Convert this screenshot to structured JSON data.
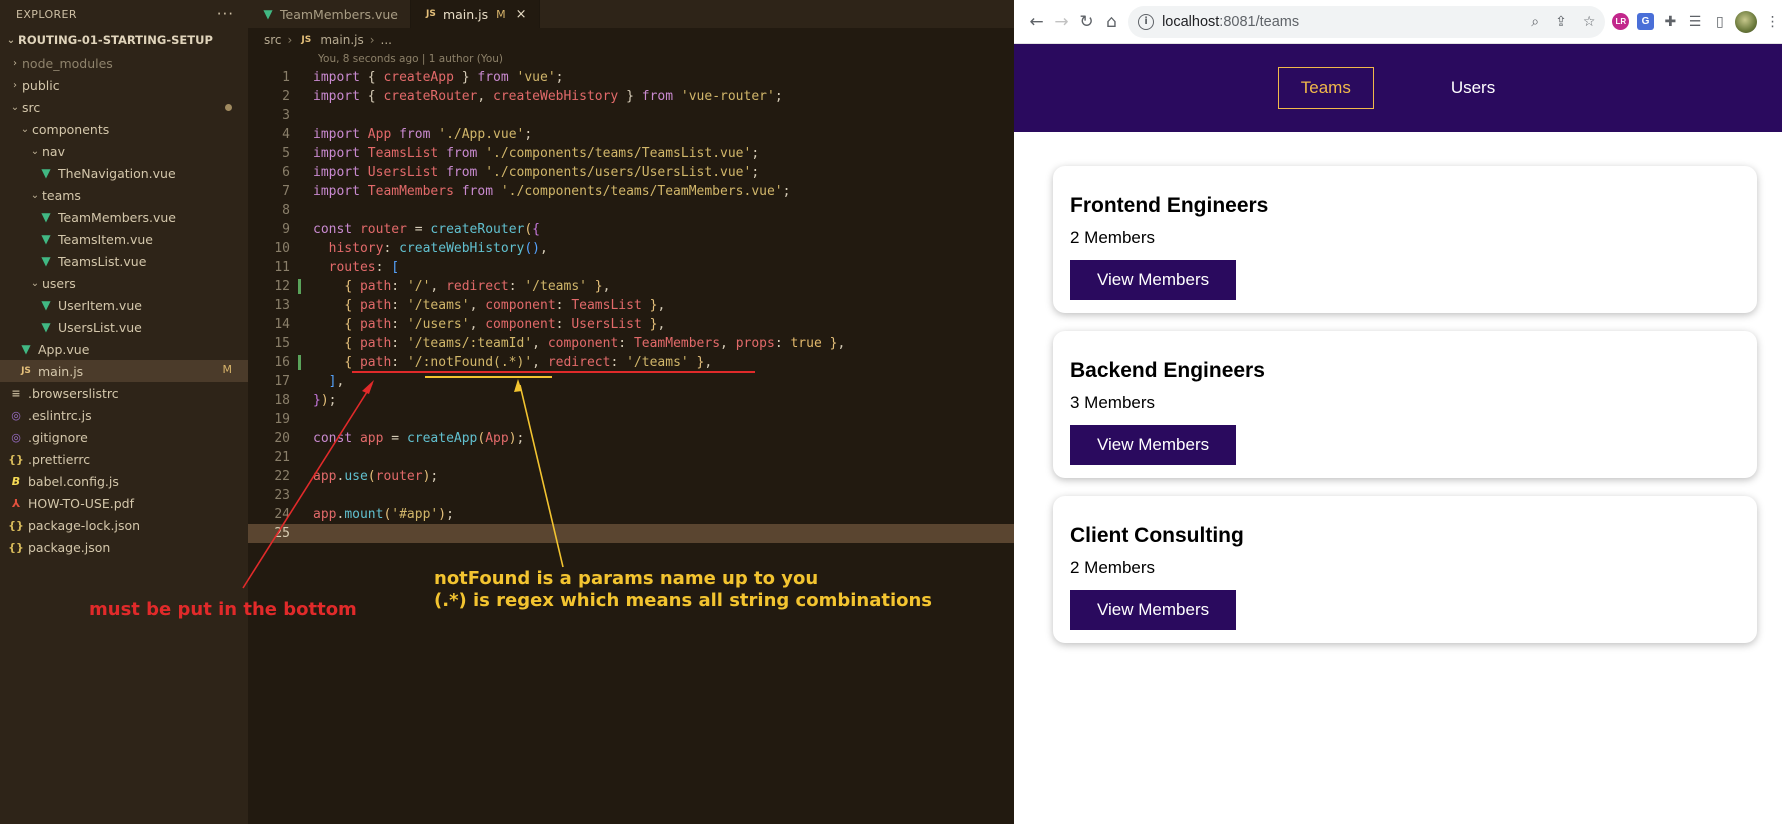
{
  "explorer": {
    "title": "EXPLORER",
    "more_label": "···",
    "project": "ROUTING-01-STARTING-SETUP",
    "items": [
      {
        "label": "node_modules",
        "kind": "folder",
        "open": false,
        "depth": 0,
        "dim": true
      },
      {
        "label": "public",
        "kind": "folder",
        "open": false,
        "depth": 0
      },
      {
        "label": "src",
        "kind": "folder",
        "open": true,
        "depth": 0,
        "dot": true
      },
      {
        "label": "components",
        "kind": "folder",
        "open": true,
        "depth": 1
      },
      {
        "label": "nav",
        "kind": "folder",
        "open": true,
        "depth": 2
      },
      {
        "label": "TheNavigation.vue",
        "kind": "vue",
        "depth": 3
      },
      {
        "label": "teams",
        "kind": "folder",
        "open": true,
        "depth": 2
      },
      {
        "label": "TeamMembers.vue",
        "kind": "vue",
        "depth": 3
      },
      {
        "label": "TeamsItem.vue",
        "kind": "vue",
        "depth": 3
      },
      {
        "label": "TeamsList.vue",
        "kind": "vue",
        "depth": 3
      },
      {
        "label": "users",
        "kind": "folder",
        "open": true,
        "depth": 2
      },
      {
        "label": "UserItem.vue",
        "kind": "vue",
        "depth": 3
      },
      {
        "label": "UsersList.vue",
        "kind": "vue",
        "depth": 3
      },
      {
        "label": "App.vue",
        "kind": "vue",
        "depth": 1
      },
      {
        "label": "main.js",
        "kind": "js",
        "depth": 1,
        "active": true,
        "badge": "M"
      },
      {
        "label": ".browserslistrc",
        "kind": "lines",
        "depth": 0
      },
      {
        "label": ".eslintrc.js",
        "kind": "circle",
        "depth": 0
      },
      {
        "label": ".gitignore",
        "kind": "circle",
        "depth": 0
      },
      {
        "label": ".prettierrc",
        "kind": "brace",
        "depth": 0
      },
      {
        "label": "babel.config.js",
        "kind": "babel",
        "depth": 0
      },
      {
        "label": "HOW-TO-USE.pdf",
        "kind": "pdf",
        "depth": 0
      },
      {
        "label": "package-lock.json",
        "kind": "brace",
        "depth": 0
      },
      {
        "label": "package.json",
        "kind": "brace",
        "depth": 0
      }
    ]
  },
  "editor": {
    "tabs": [
      {
        "label": "TeamMembers.vue",
        "icon": "vue-icon",
        "active": false
      },
      {
        "label": "main.js",
        "icon": "js-icon",
        "active": true,
        "modified": "M",
        "close": "×"
      }
    ],
    "breadcrumb": [
      "src",
      "main.js",
      "..."
    ],
    "blame": "You, 8 seconds ago | 1 author (You)",
    "current_line": 25,
    "lines": [
      [
        [
          "k",
          "import "
        ],
        [
          "o",
          "{ "
        ],
        [
          "v",
          "createApp"
        ],
        [
          "o",
          " } "
        ],
        [
          "k",
          "from "
        ],
        [
          "s",
          "'vue'"
        ],
        [
          "o",
          ";"
        ]
      ],
      [
        [
          "k",
          "import "
        ],
        [
          "o",
          "{ "
        ],
        [
          "v",
          "createRouter"
        ],
        [
          "o",
          ", "
        ],
        [
          "v",
          "createWebHistory"
        ],
        [
          "o",
          " } "
        ],
        [
          "k",
          "from "
        ],
        [
          "s",
          "'vue-router'"
        ],
        [
          "o",
          ";"
        ]
      ],
      [],
      [
        [
          "k",
          "import "
        ],
        [
          "v",
          "App "
        ],
        [
          "k",
          "from "
        ],
        [
          "s",
          "'./App.vue'"
        ],
        [
          "o",
          ";"
        ]
      ],
      [
        [
          "k",
          "import "
        ],
        [
          "v",
          "TeamsList "
        ],
        [
          "k",
          "from "
        ],
        [
          "s",
          "'./components/teams/TeamsList.vue'"
        ],
        [
          "o",
          ";"
        ]
      ],
      [
        [
          "k",
          "import "
        ],
        [
          "v",
          "UsersList "
        ],
        [
          "k",
          "from "
        ],
        [
          "s",
          "'./components/users/UsersList.vue'"
        ],
        [
          "o",
          ";"
        ]
      ],
      [
        [
          "k",
          "import "
        ],
        [
          "v",
          "TeamMembers "
        ],
        [
          "k",
          "from "
        ],
        [
          "s",
          "'./components/teams/TeamMembers.vue'"
        ],
        [
          "o",
          ";"
        ]
      ],
      [],
      [
        [
          "k",
          "const "
        ],
        [
          "v",
          "router "
        ],
        [
          "o",
          "= "
        ],
        [
          "f",
          "createRouter"
        ],
        [
          "p1",
          "("
        ],
        [
          "p2",
          "{"
        ]
      ],
      [
        [
          "o",
          "  "
        ],
        [
          "v",
          "history"
        ],
        [
          "o",
          ": "
        ],
        [
          "f",
          "createWebHistory"
        ],
        [
          "p3",
          "()"
        ],
        [
          "o",
          ","
        ]
      ],
      [
        [
          "o",
          "  "
        ],
        [
          "v",
          "routes"
        ],
        [
          "o",
          ": "
        ],
        [
          "p3",
          "["
        ]
      ],
      [
        [
          "o",
          "    "
        ],
        [
          "p1",
          "{ "
        ],
        [
          "v",
          "path"
        ],
        [
          "o",
          ": "
        ],
        [
          "s",
          "'/'"
        ],
        [
          "o",
          ", "
        ],
        [
          "v",
          "redirect"
        ],
        [
          "o",
          ": "
        ],
        [
          "s",
          "'/teams'"
        ],
        [
          "p1",
          " }"
        ],
        [
          "o",
          ","
        ]
      ],
      [
        [
          "o",
          "    "
        ],
        [
          "p1",
          "{ "
        ],
        [
          "v",
          "path"
        ],
        [
          "o",
          ": "
        ],
        [
          "s",
          "'/teams'"
        ],
        [
          "o",
          ", "
        ],
        [
          "v",
          "component"
        ],
        [
          "o",
          ": "
        ],
        [
          "v",
          "TeamsList"
        ],
        [
          "p1",
          " }"
        ],
        [
          "o",
          ","
        ]
      ],
      [
        [
          "o",
          "    "
        ],
        [
          "p1",
          "{ "
        ],
        [
          "v",
          "path"
        ],
        [
          "o",
          ": "
        ],
        [
          "s",
          "'/users'"
        ],
        [
          "o",
          ", "
        ],
        [
          "v",
          "component"
        ],
        [
          "o",
          ": "
        ],
        [
          "v",
          "UsersList"
        ],
        [
          "p1",
          " }"
        ],
        [
          "o",
          ","
        ]
      ],
      [
        [
          "o",
          "    "
        ],
        [
          "p1",
          "{ "
        ],
        [
          "v",
          "path"
        ],
        [
          "o",
          ": "
        ],
        [
          "s",
          "'/teams/:teamId'"
        ],
        [
          "o",
          ", "
        ],
        [
          "v",
          "component"
        ],
        [
          "o",
          ": "
        ],
        [
          "v",
          "TeamMembers"
        ],
        [
          "o",
          ", "
        ],
        [
          "v",
          "props"
        ],
        [
          "o",
          ": "
        ],
        [
          "kw2",
          "true"
        ],
        [
          "p1",
          " }"
        ],
        [
          "o",
          ","
        ]
      ],
      [
        [
          "o",
          "    "
        ],
        [
          "p1",
          "{ "
        ],
        [
          "v",
          "path"
        ],
        [
          "o",
          ": "
        ],
        [
          "s",
          "'/:notFound(.*)'"
        ],
        [
          "o",
          ", "
        ],
        [
          "v",
          "redirect"
        ],
        [
          "o",
          ": "
        ],
        [
          "s",
          "'/teams'"
        ],
        [
          "p1",
          " }"
        ],
        [
          "o",
          ","
        ]
      ],
      [
        [
          "o",
          "  "
        ],
        [
          "p3",
          "]"
        ],
        [
          "o",
          ","
        ]
      ],
      [
        [
          "p2",
          "}"
        ],
        [
          "p1",
          ")"
        ],
        [
          "o",
          ";"
        ]
      ],
      [],
      [
        [
          "k",
          "const "
        ],
        [
          "v",
          "app "
        ],
        [
          "o",
          "= "
        ],
        [
          "f",
          "createApp"
        ],
        [
          "p1",
          "("
        ],
        [
          "v",
          "App"
        ],
        [
          "p1",
          ")"
        ],
        [
          "o",
          ";"
        ]
      ],
      [],
      [
        [
          "v",
          "app"
        ],
        [
          "o",
          "."
        ],
        [
          "f",
          "use"
        ],
        [
          "p1",
          "("
        ],
        [
          "v",
          "router"
        ],
        [
          "p1",
          ")"
        ],
        [
          "o",
          ";"
        ]
      ],
      [],
      [
        [
          "v",
          "app"
        ],
        [
          "o",
          "."
        ],
        [
          "f",
          "mount"
        ],
        [
          "p1",
          "("
        ],
        [
          "s",
          "'#app'"
        ],
        [
          "p1",
          ")"
        ],
        [
          "o",
          ";"
        ]
      ],
      []
    ]
  },
  "annotations": {
    "red_note": "must be put in the bottom",
    "yellow_note_line1": "notFound is a params name up to you",
    "yellow_note_line2": "(.*) is regex which means all string combinations",
    "red_color": "#e12a2a",
    "yellow_color": "#f3c430"
  },
  "browser": {
    "url_host": "localhost",
    "url_path": ":8081/teams",
    "nav": {
      "teams": "Teams",
      "users": "Users"
    },
    "teams": [
      {
        "name": "Frontend Engineers",
        "members": "2 Members",
        "button": "View Members"
      },
      {
        "name": "Backend Engineers",
        "members": "3 Members",
        "button": "View Members"
      },
      {
        "name": "Client Consulting",
        "members": "2 Members",
        "button": "View Members"
      }
    ],
    "colors": {
      "header": "#2a0a5e",
      "active_link": "#f1b94a"
    }
  }
}
